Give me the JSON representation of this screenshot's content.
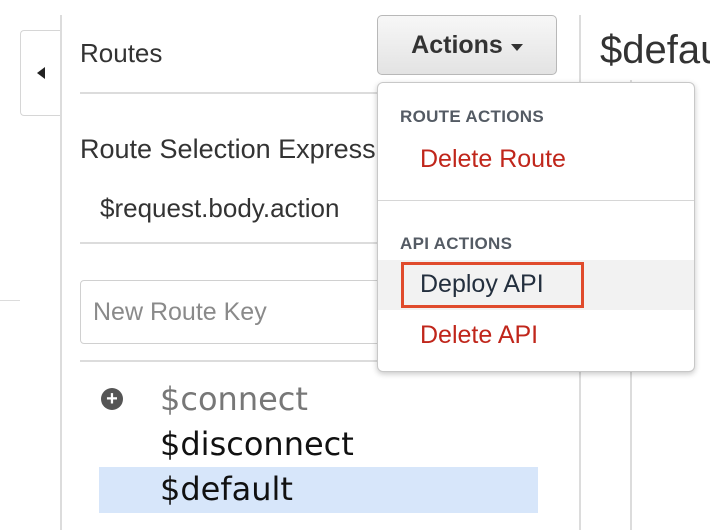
{
  "routes_panel": {
    "title": "Routes",
    "route_selection_label": "Route Selection Expression",
    "route_selection_value": "$request.body.action",
    "new_route_placeholder": "New Route Key",
    "routes": [
      "$connect",
      "$disconnect",
      "$default"
    ],
    "selected_route": "$default"
  },
  "actions_button": {
    "label": "Actions"
  },
  "detail_title": "$default",
  "actions_menu": {
    "route_actions_header": "ROUTE ACTIONS",
    "delete_route": "Delete Route",
    "api_actions_header": "API ACTIONS",
    "deploy_api": "Deploy API",
    "delete_api": "Delete API"
  },
  "colors": {
    "danger": "#c0261b",
    "selected_row": "#d7e6fa",
    "highlight": "#e04b2c"
  },
  "icons": [
    "chevron-left-icon",
    "caret-down-icon",
    "plus-circle-icon"
  ]
}
